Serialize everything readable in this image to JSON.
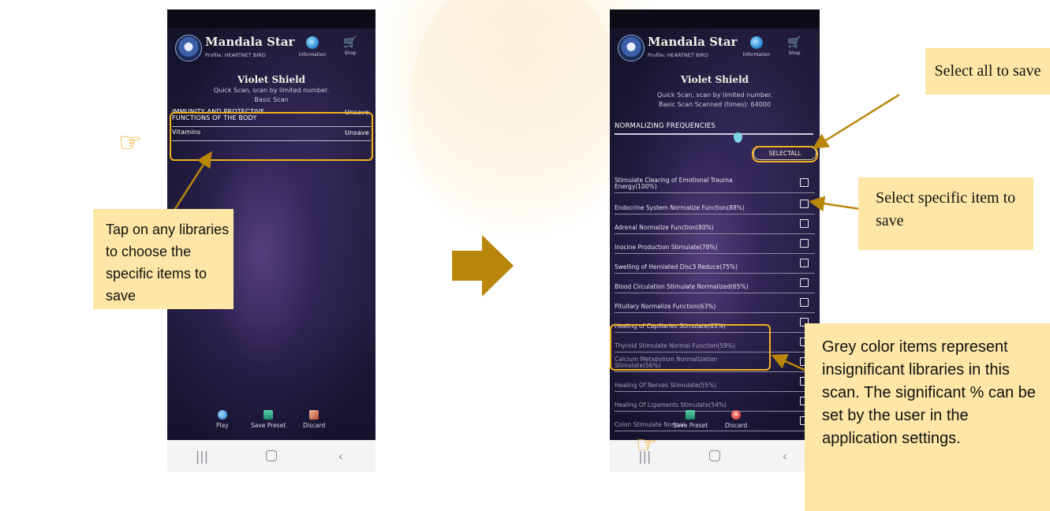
{
  "app": {
    "title": "Mandala Star",
    "profile": "Profile: HEARTNET BIRD",
    "info_label": "Information",
    "shop_label": "Shop",
    "info_icon": "info-icon",
    "shop_icon": "cart-icon"
  },
  "left_screen": {
    "title": "Violet Shield",
    "subtitle": "Quick Scan, scan by limited number.",
    "scan_type": "Basic Scan",
    "libraries": [
      {
        "name": "IMMUNITY AND PROTECTIVE FUNCTIONS OF THE BODY",
        "action": "Unsave"
      },
      {
        "name": "Vitamins",
        "action": "Unsave"
      }
    ],
    "bottom": {
      "play": "Play",
      "save_preset": "Save Preset",
      "discard": "Discard"
    }
  },
  "right_screen": {
    "title": "Violet Shield",
    "subtitle": "Quick Scan, scan by limited number.",
    "scan_count": "Basic Scan Scanned (times): 64000",
    "section": "NORMALIZING FREQUENCIES",
    "select_all": "SELECTALL",
    "items": [
      {
        "name": "Stimulate Clearing of Emotional Trauma Energy(100%)",
        "grey": false
      },
      {
        "name": "Endocrine System Normalize Function(88%)",
        "grey": false
      },
      {
        "name": "Adrenal Normalize Function(80%)",
        "grey": false
      },
      {
        "name": "Inocine Production Stimulate(78%)",
        "grey": false
      },
      {
        "name": "Swelling of Herniated Disc3 Reduce(75%)",
        "grey": false
      },
      {
        "name": "Blood Circulation Stimulate Normalized(65%)",
        "grey": false
      },
      {
        "name": "Pituitary Normalize Function(63%)",
        "grey": false
      },
      {
        "name": "Healing of Capillaries Stimulate(63%)",
        "grey": false
      },
      {
        "name": "Thyroid Stimulate Normal Function(59%)",
        "grey": true
      },
      {
        "name": "Calcium Metabolism Normalization Stimulate(56%)",
        "grey": true
      },
      {
        "name": "Healing Of Nerves Stimulate(55%)",
        "grey": true
      },
      {
        "name": "Healing Of Ligaments Stimulate(54%)",
        "grey": true
      },
      {
        "name": "Colon Stimulate Normal",
        "grey": true
      }
    ],
    "bottom": {
      "save_preset": "Save Preset",
      "discard": "Discard"
    }
  },
  "callouts": {
    "left": "Tap on any libraries to choose the specific items to save",
    "select_all": "Select all to save",
    "select_item": "Select specific item to save",
    "grey": "Grey color items represent insignificant libraries in this scan. The significant % can be set by the user in the application settings."
  },
  "colors": {
    "accent": "#f2b11f",
    "callout_bg": "#fde6a6",
    "arrow": "#b8860b"
  }
}
